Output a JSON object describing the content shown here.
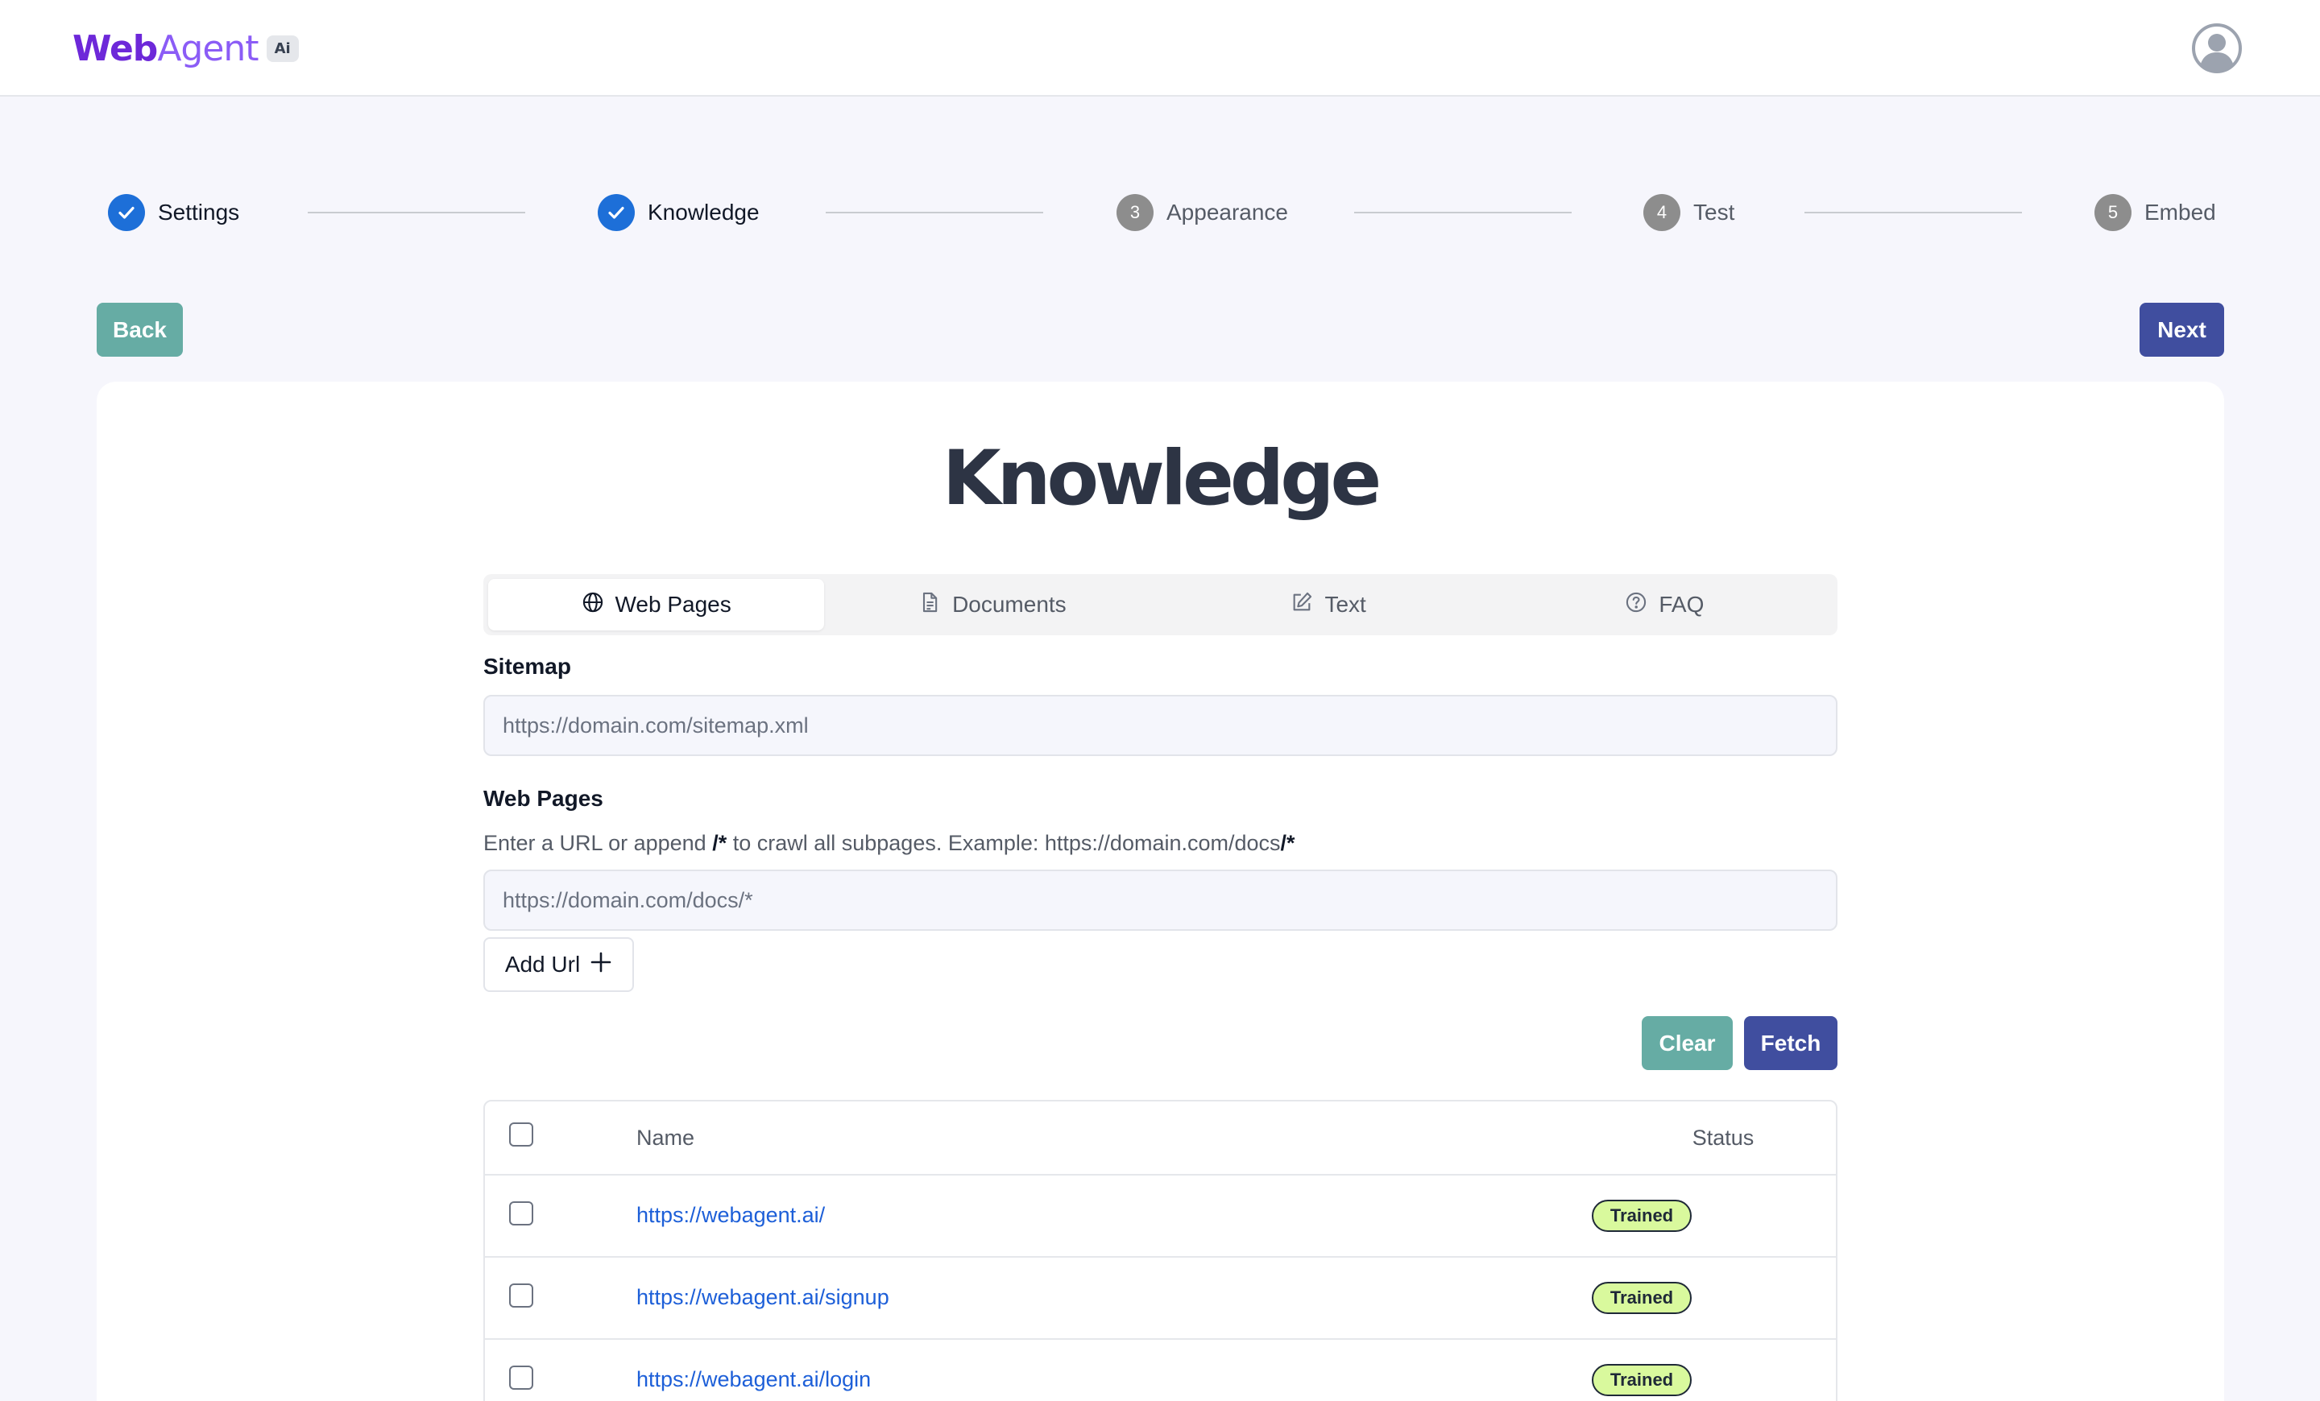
{
  "header": {
    "logo_web": "Web",
    "logo_agent": "Agent",
    "logo_badge": "Ai"
  },
  "stepper": {
    "steps": [
      {
        "label": "Settings",
        "number": "1",
        "state": "complete"
      },
      {
        "label": "Knowledge",
        "number": "2",
        "state": "complete"
      },
      {
        "label": "Appearance",
        "number": "3",
        "state": "pending"
      },
      {
        "label": "Test",
        "number": "4",
        "state": "pending"
      },
      {
        "label": "Embed",
        "number": "5",
        "state": "pending"
      }
    ]
  },
  "nav": {
    "back_label": "Back",
    "next_label": "Next"
  },
  "page": {
    "title": "Knowledge"
  },
  "tabs": [
    {
      "label": "Web Pages",
      "icon": "globe-icon",
      "active": true
    },
    {
      "label": "Documents",
      "icon": "document-icon",
      "active": false
    },
    {
      "label": "Text",
      "icon": "edit-icon",
      "active": false
    },
    {
      "label": "FAQ",
      "icon": "help-circle-icon",
      "active": false
    }
  ],
  "form": {
    "sitemap_label": "Sitemap",
    "sitemap_placeholder": "https://domain.com/sitemap.xml",
    "webpages_label": "Web Pages",
    "help_prefix": "Enter a URL or append ",
    "help_token1": "/*",
    "help_middle": " to crawl all subpages. Example: https://domain.com/docs",
    "help_token2": "/*",
    "url_placeholder": "https://domain.com/docs/*",
    "add_url_label": "Add Url",
    "clear_label": "Clear",
    "fetch_label": "Fetch"
  },
  "table": {
    "columns": {
      "name": "Name",
      "status": "Status"
    },
    "rows": [
      {
        "url": "https://webagent.ai/",
        "status": "Trained",
        "checked": false
      },
      {
        "url": "https://webagent.ai/signup",
        "status": "Trained",
        "checked": false
      },
      {
        "url": "https://webagent.ai/login",
        "status": "Trained",
        "checked": false
      }
    ]
  },
  "colors": {
    "primary": "#404e9f",
    "secondary": "#66aca4",
    "step_done": "#1d6fd8",
    "link": "#1d5fd8",
    "status_pill": "#d9f99d"
  }
}
